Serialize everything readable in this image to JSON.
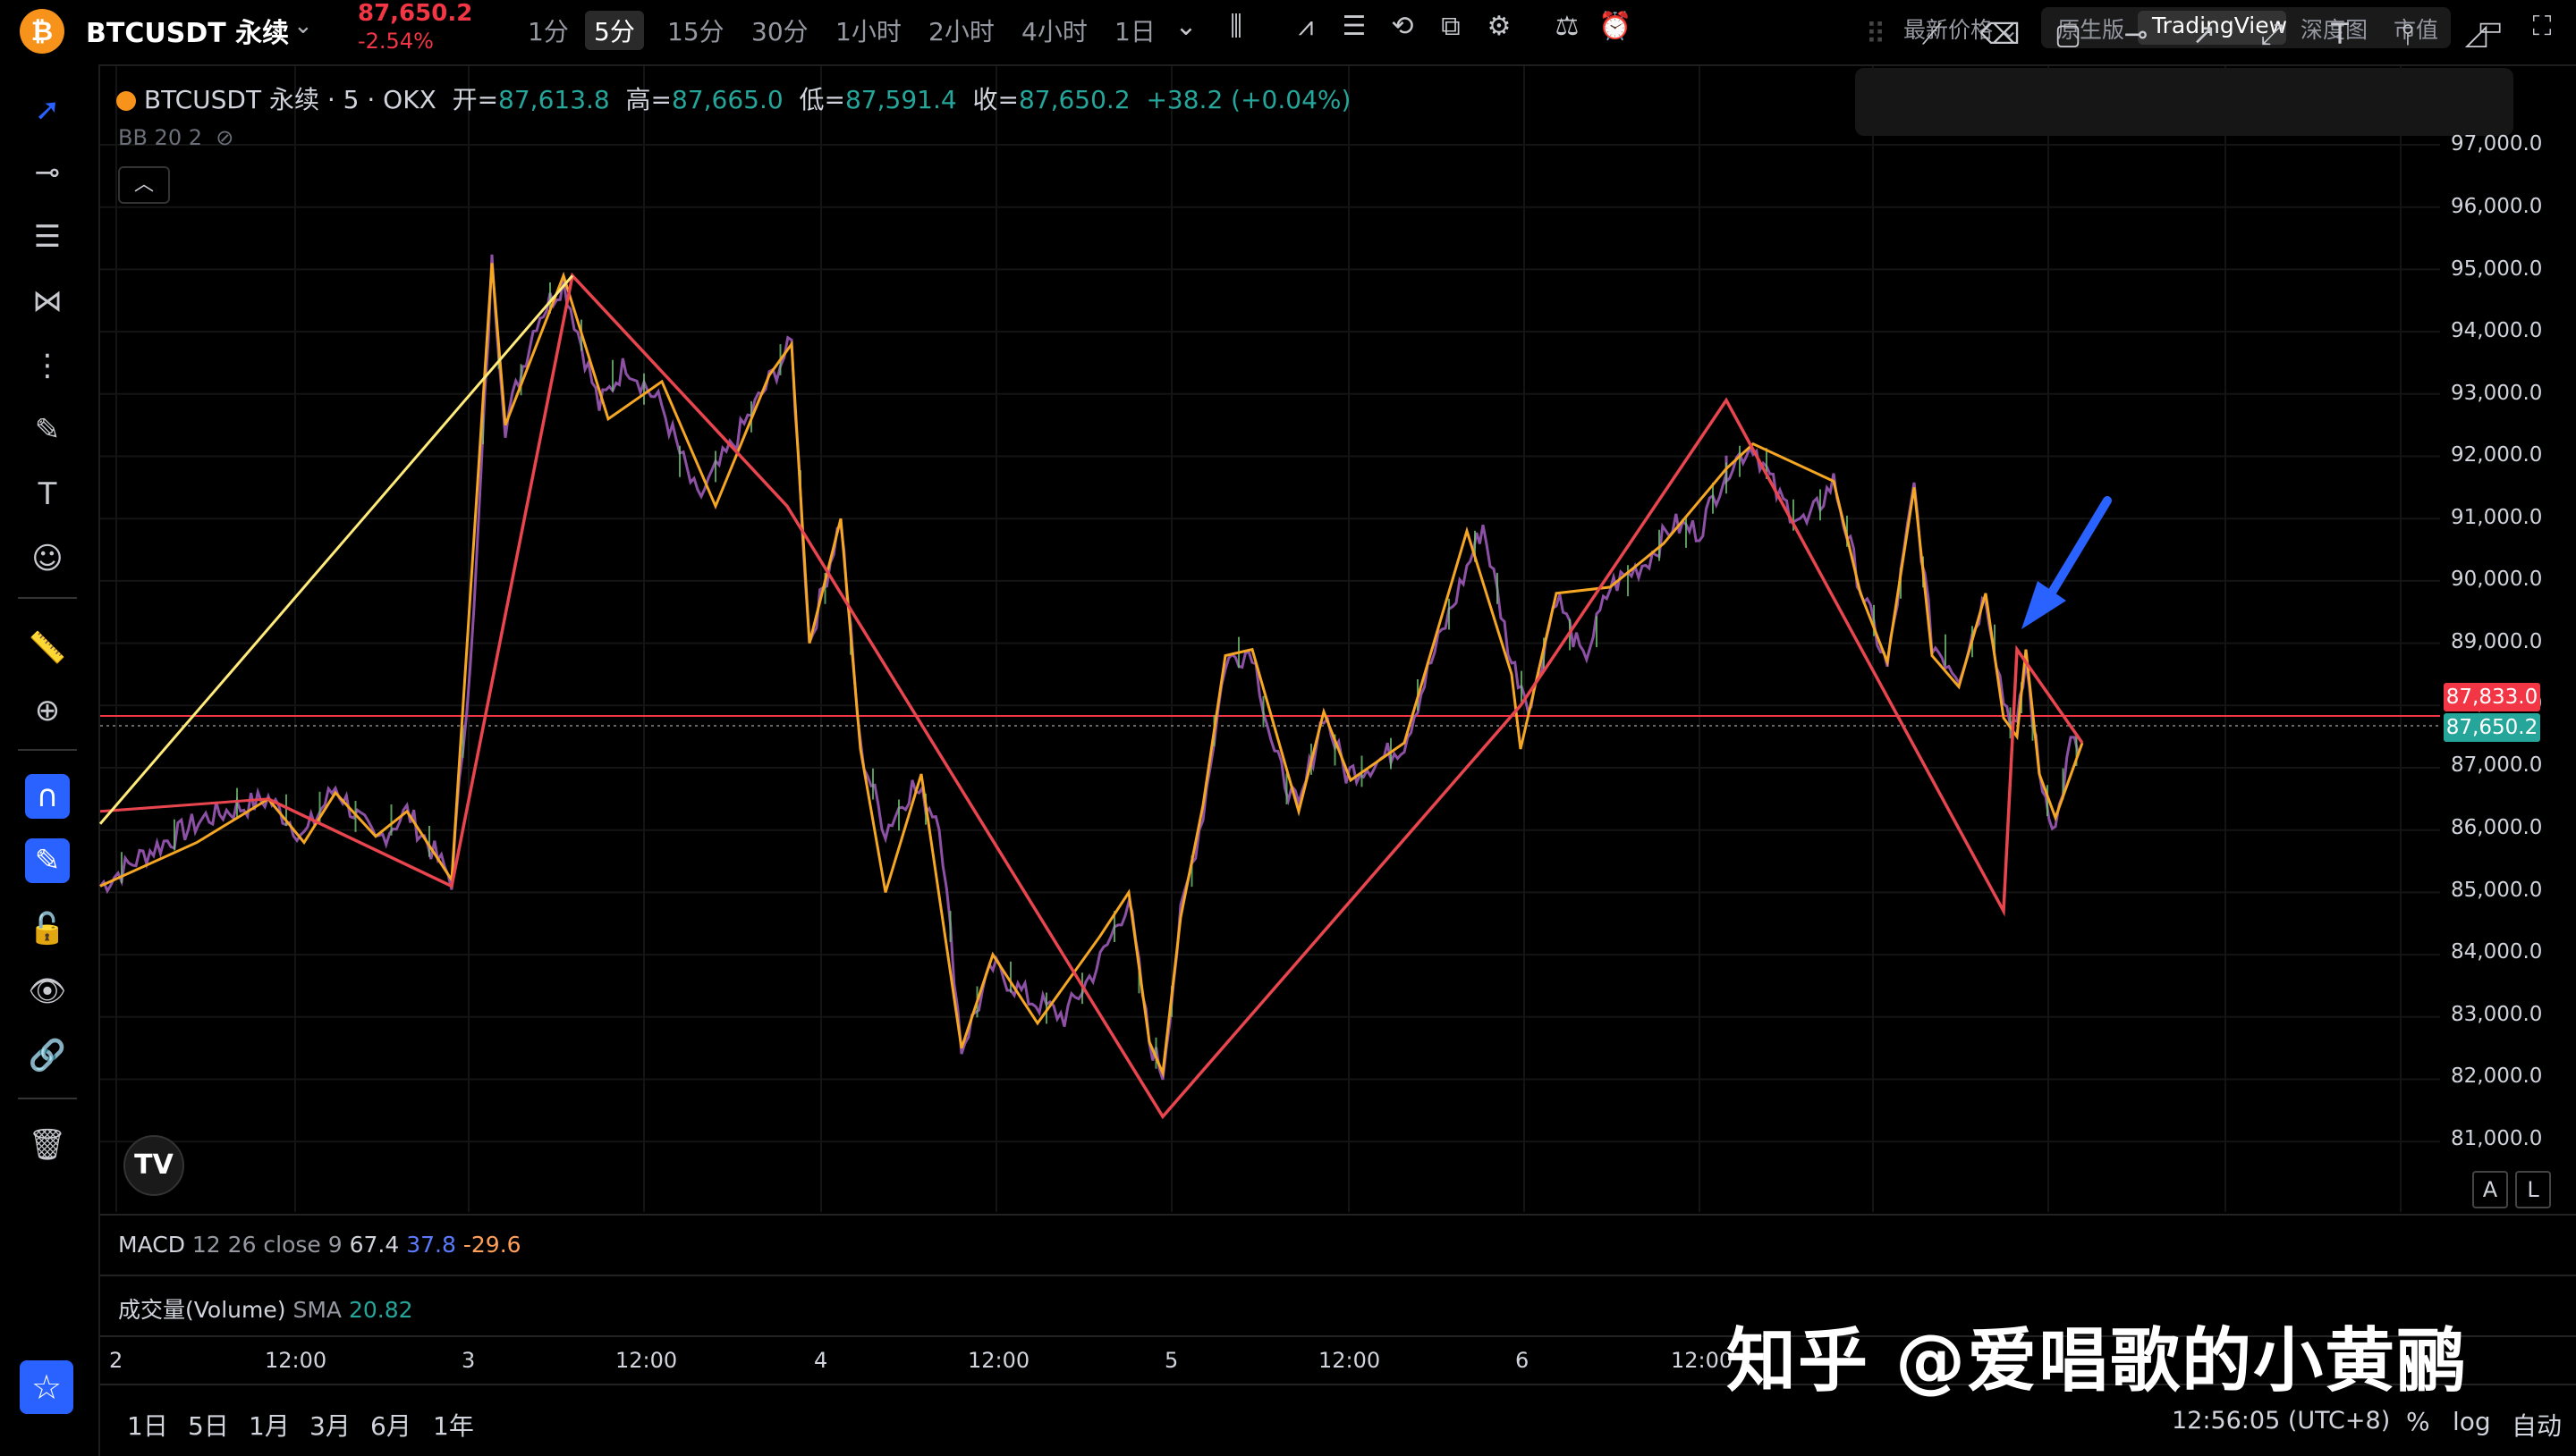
{
  "header": {
    "symbol": "BTCUSDT 永续",
    "coin_glyph": "₿",
    "last_price": "87,650.2",
    "change_pct": "-2.54%",
    "timeframes": [
      "1分",
      "5分",
      "15分",
      "30分",
      "1小时",
      "2小时",
      "4小时",
      "1日"
    ],
    "active_timeframe": "5分",
    "price_mode": "最新价格",
    "views": [
      "原生版",
      "TradingView",
      "深度图",
      "市值"
    ],
    "active_view": "TradingView"
  },
  "legend": {
    "title": "BTCUSDT 永续 · 5 · OKX",
    "open_label": "开=",
    "open": "87,613.8",
    "high_label": "高=",
    "high": "87,665.0",
    "low_label": "低=",
    "low": "87,591.4",
    "close_label": "收=",
    "close": "87,650.2",
    "delta": "+38.2 (+0.04%)",
    "bb": "BB 20 2"
  },
  "indicators": {
    "macd_name": "MACD",
    "macd_params": "12 26 close 9",
    "macd_v1": "67.4",
    "macd_v2": "37.8",
    "macd_v3": "-29.6",
    "vol_name": "成交量(Volume)",
    "vol_sma": "SMA",
    "vol_value": "20.82"
  },
  "price_axis": {
    "labels": [
      "97,000.0",
      "96,000.0",
      "95,000.0",
      "94,000.0",
      "93,000.0",
      "92,000.0",
      "91,000.0",
      "90,000.0",
      "89,000.0",
      "88,000.0",
      "87,000.0",
      "86,000.0",
      "85,000.0",
      "84,000.0",
      "83,000.0",
      "82,000.0",
      "81,000.0"
    ],
    "tag_red": "87,833.0",
    "tag_green": "87,650.2"
  },
  "time_axis": {
    "labels": [
      "2",
      "12:00",
      "3",
      "12:00",
      "4",
      "12:00",
      "5",
      "12:00",
      "6",
      "12:00"
    ]
  },
  "ranges": [
    "1日",
    "5日",
    "1月",
    "3月",
    "6月",
    "1年"
  ],
  "clock": "12:56:05 (UTC+8)",
  "bottom_right": {
    "pct": "%",
    "log": "log",
    "auto": "自动"
  },
  "scale_buttons": {
    "a": "A",
    "l": "L"
  },
  "watermark": "知乎 @爱唱歌的小黄鹂",
  "tv_logo": "TV",
  "colors": {
    "up": "#26a69a",
    "down": "#f23645",
    "zigzag_red": "#e8454f",
    "zigzag_orange": "#f5a623",
    "trend_yellow": "#ffeb7a",
    "arrow_blue": "#2962ff"
  }
}
